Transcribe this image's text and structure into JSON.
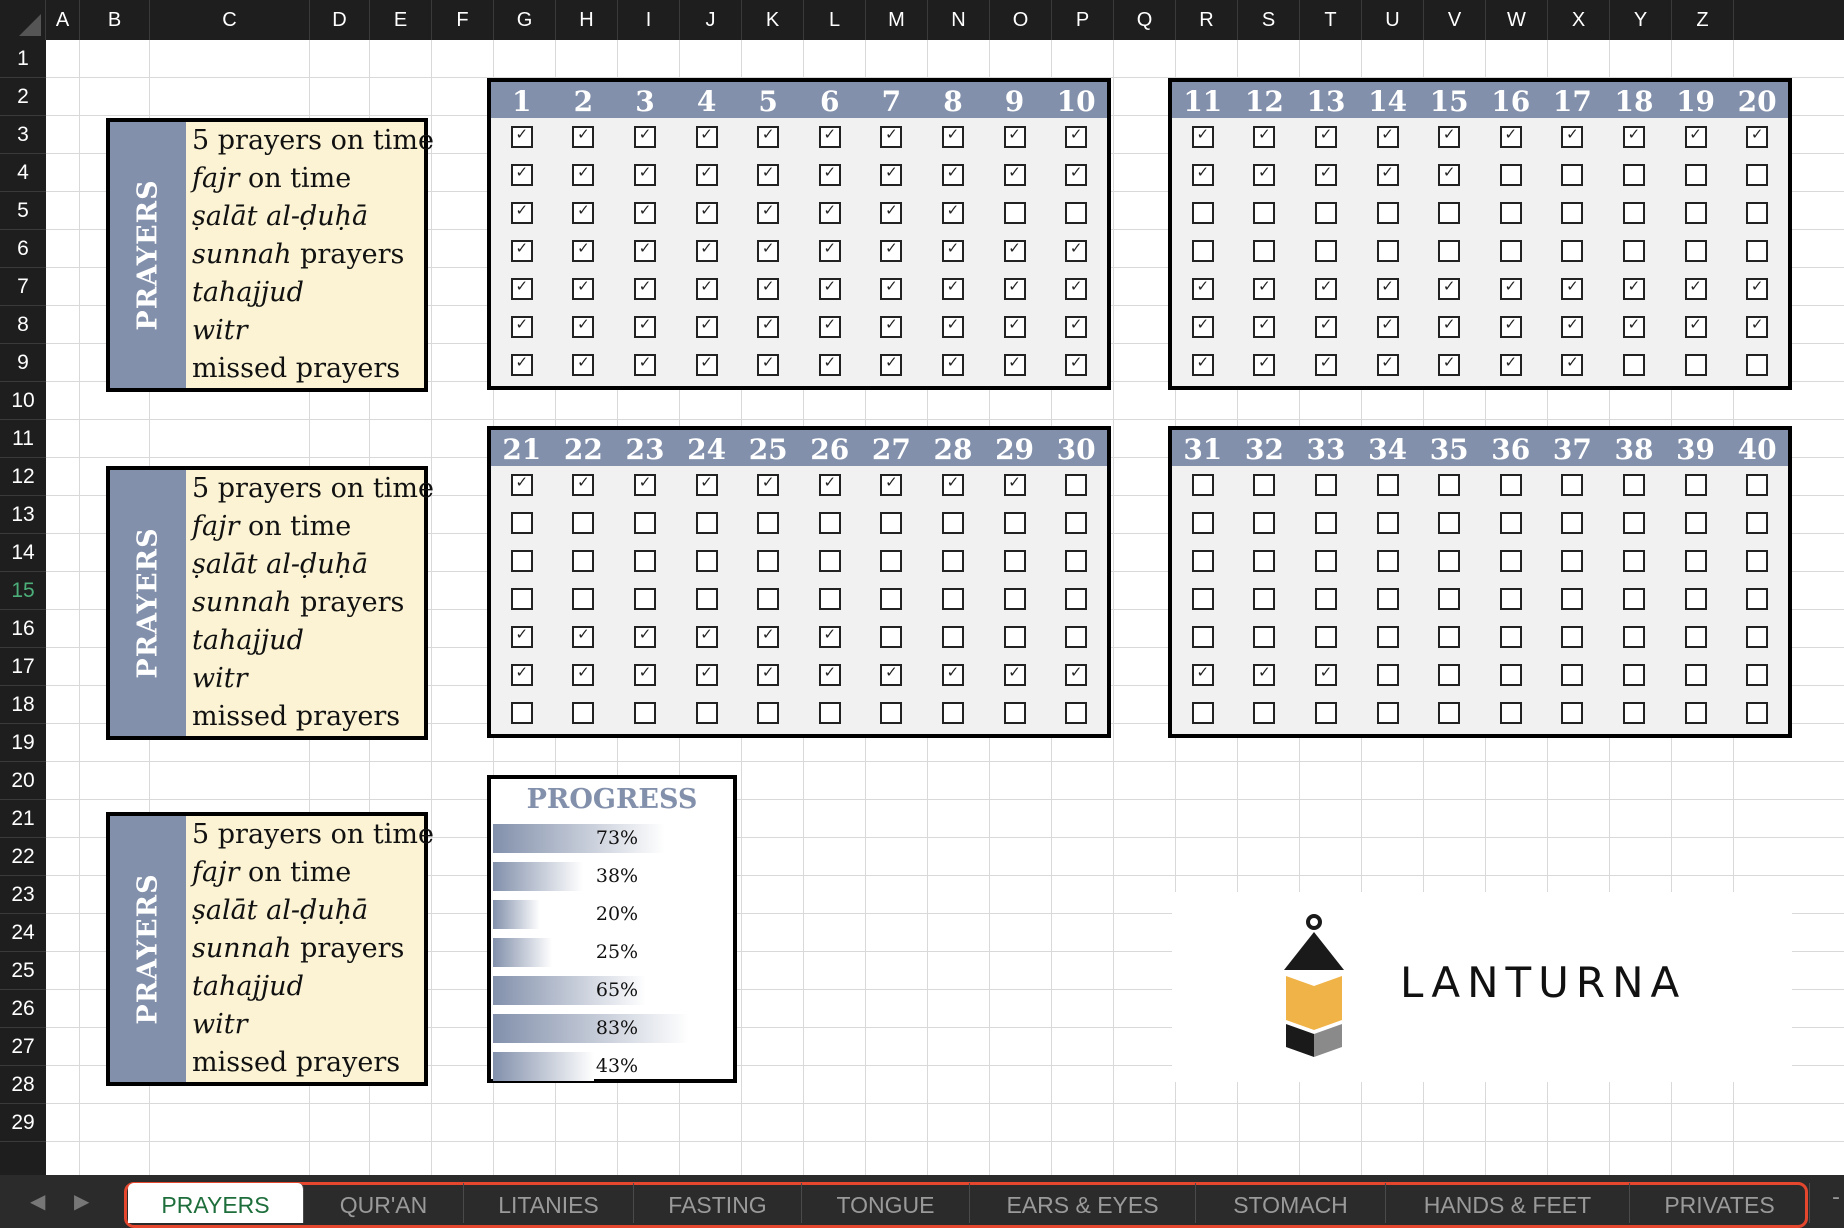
{
  "columns": [
    "A",
    "B",
    "C",
    "D",
    "E",
    "F",
    "G",
    "H",
    "I",
    "J",
    "K",
    "L",
    "M",
    "N",
    "O",
    "P",
    "Q",
    "R",
    "S",
    "T",
    "U",
    "V",
    "W",
    "X",
    "Y",
    "Z"
  ],
  "rows": [
    "1",
    "2",
    "3",
    "4",
    "5",
    "6",
    "7",
    "8",
    "9",
    "10",
    "11",
    "12",
    "13",
    "14",
    "15",
    "16",
    "17",
    "18",
    "19",
    "20",
    "21",
    "22",
    "23",
    "24",
    "25",
    "26",
    "27",
    "28",
    "29"
  ],
  "selected_row": "15",
  "label_boxes": [
    {
      "side": "PRAYERS",
      "items": [
        {
          "it": "",
          "rest": "5 prayers on time"
        },
        {
          "it": "fajr",
          "rest": " on time"
        },
        {
          "it": "ṣalāt al-ḍuḥā",
          "rest": ""
        },
        {
          "it": "sunnah",
          "rest": " prayers"
        },
        {
          "it": "tahajjud",
          "rest": ""
        },
        {
          "it": "witr",
          "rest": ""
        },
        {
          "it": "",
          "rest": "missed prayers"
        }
      ]
    },
    {
      "side": "PRAYERS",
      "items": [
        {
          "it": "",
          "rest": "5 prayers on time"
        },
        {
          "it": "fajr",
          "rest": " on time"
        },
        {
          "it": "ṣalāt al-ḍuḥā",
          "rest": ""
        },
        {
          "it": "sunnah",
          "rest": " prayers"
        },
        {
          "it": "tahajjud",
          "rest": ""
        },
        {
          "it": "witr",
          "rest": ""
        },
        {
          "it": "",
          "rest": "missed prayers"
        }
      ]
    },
    {
      "side": "PRAYERS",
      "items": [
        {
          "it": "",
          "rest": "5 prayers on time"
        },
        {
          "it": "fajr",
          "rest": " on time"
        },
        {
          "it": "ṣalāt al-ḍuḥā",
          "rest": ""
        },
        {
          "it": "sunnah",
          "rest": " prayers"
        },
        {
          "it": "tahajjud",
          "rest": ""
        },
        {
          "it": "witr",
          "rest": ""
        },
        {
          "it": "",
          "rest": "missed prayers"
        }
      ]
    }
  ],
  "day_blocks": [
    {
      "days": [
        "1",
        "2",
        "3",
        "4",
        "5",
        "6",
        "7",
        "8",
        "9",
        "10"
      ],
      "checks": [
        [
          1,
          1,
          1,
          1,
          1,
          1,
          1,
          1,
          1,
          1
        ],
        [
          1,
          1,
          1,
          1,
          1,
          1,
          1,
          1,
          1,
          1
        ],
        [
          1,
          1,
          1,
          1,
          1,
          1,
          1,
          1,
          0,
          0
        ],
        [
          1,
          1,
          1,
          1,
          1,
          1,
          1,
          1,
          1,
          1
        ],
        [
          1,
          1,
          1,
          1,
          1,
          1,
          1,
          1,
          1,
          1
        ],
        [
          1,
          1,
          1,
          1,
          1,
          1,
          1,
          1,
          1,
          1
        ],
        [
          1,
          1,
          1,
          1,
          1,
          1,
          1,
          1,
          1,
          1
        ]
      ]
    },
    {
      "days": [
        "11",
        "12",
        "13",
        "14",
        "15",
        "16",
        "17",
        "18",
        "19",
        "20"
      ],
      "checks": [
        [
          1,
          1,
          1,
          1,
          1,
          1,
          1,
          1,
          1,
          1
        ],
        [
          1,
          1,
          1,
          1,
          1,
          0,
          0,
          0,
          0,
          0
        ],
        [
          0,
          0,
          0,
          0,
          0,
          0,
          0,
          0,
          0,
          0
        ],
        [
          0,
          0,
          0,
          0,
          0,
          0,
          0,
          0,
          0,
          0
        ],
        [
          1,
          1,
          1,
          1,
          1,
          1,
          1,
          1,
          1,
          1
        ],
        [
          1,
          1,
          1,
          1,
          1,
          1,
          1,
          1,
          1,
          1
        ],
        [
          1,
          1,
          1,
          1,
          1,
          1,
          1,
          0,
          0,
          0
        ]
      ]
    },
    {
      "days": [
        "21",
        "22",
        "23",
        "24",
        "25",
        "26",
        "27",
        "28",
        "29",
        "30"
      ],
      "checks": [
        [
          1,
          1,
          1,
          1,
          1,
          1,
          1,
          1,
          1,
          0
        ],
        [
          0,
          0,
          0,
          0,
          0,
          0,
          0,
          0,
          0,
          0
        ],
        [
          0,
          0,
          0,
          0,
          0,
          0,
          0,
          0,
          0,
          0
        ],
        [
          0,
          0,
          0,
          0,
          0,
          0,
          0,
          0,
          0,
          0
        ],
        [
          1,
          1,
          1,
          1,
          1,
          1,
          0,
          0,
          0,
          0
        ],
        [
          1,
          1,
          1,
          1,
          1,
          1,
          1,
          1,
          1,
          1
        ],
        [
          0,
          0,
          0,
          0,
          0,
          0,
          0,
          0,
          0,
          0
        ]
      ]
    },
    {
      "days": [
        "31",
        "32",
        "33",
        "34",
        "35",
        "36",
        "37",
        "38",
        "39",
        "40"
      ],
      "checks": [
        [
          0,
          0,
          0,
          0,
          0,
          0,
          0,
          0,
          0,
          0
        ],
        [
          0,
          0,
          0,
          0,
          0,
          0,
          0,
          0,
          0,
          0
        ],
        [
          0,
          0,
          0,
          0,
          0,
          0,
          0,
          0,
          0,
          0
        ],
        [
          0,
          0,
          0,
          0,
          0,
          0,
          0,
          0,
          0,
          0
        ],
        [
          0,
          0,
          0,
          0,
          0,
          0,
          0,
          0,
          0,
          0
        ],
        [
          1,
          1,
          1,
          0,
          0,
          0,
          0,
          0,
          0,
          0
        ],
        [
          0,
          0,
          0,
          0,
          0,
          0,
          0,
          0,
          0,
          0
        ]
      ]
    }
  ],
  "progress": {
    "title": "PROGRESS",
    "items": [
      {
        "label": "73%",
        "value": 0.73
      },
      {
        "label": "38%",
        "value": 0.38
      },
      {
        "label": "20%",
        "value": 0.2
      },
      {
        "label": "25%",
        "value": 0.25
      },
      {
        "label": "65%",
        "value": 0.65
      },
      {
        "label": "83%",
        "value": 0.83
      },
      {
        "label": "43%",
        "value": 0.43
      }
    ]
  },
  "logo": {
    "text": "LANTURNA",
    "colors": {
      "dark": "#1a1a1a",
      "gold": "#f0b347",
      "gray": "#8a8a8a"
    }
  },
  "tabs": [
    {
      "label": "PRAYERS",
      "active": true
    },
    {
      "label": "QUR'AN",
      "active": false
    },
    {
      "label": "LITANIES",
      "active": false
    },
    {
      "label": "FASTING",
      "active": false
    },
    {
      "label": "TONGUE",
      "active": false
    },
    {
      "label": "EARS & EYES",
      "active": false
    },
    {
      "label": "STOMACH",
      "active": false
    },
    {
      "label": "HANDS & FEET",
      "active": false
    },
    {
      "label": "PRIVATES",
      "active": false
    }
  ],
  "theme": {
    "header_blue": "#8290ab",
    "label_bg": "#fbf3d3",
    "tab_outline": "#e5472e",
    "active_tab_text": "#1e6e3c"
  }
}
